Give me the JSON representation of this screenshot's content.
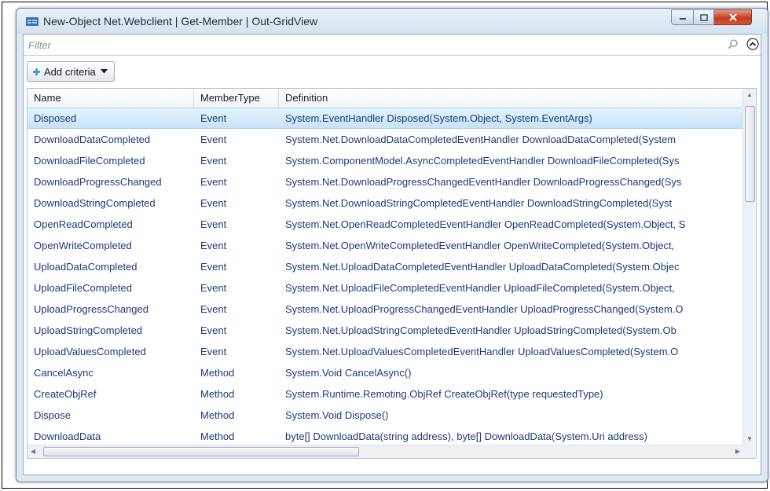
{
  "window": {
    "title": "New-Object Net.Webclient | Get-Member | Out-GridView"
  },
  "filter": {
    "placeholder": "Filter"
  },
  "toolbar": {
    "add_criteria_label": "Add criteria"
  },
  "grid": {
    "columns": [
      "Name",
      "MemberType",
      "Definition"
    ],
    "rows": [
      {
        "name": "Disposed",
        "type": "Event",
        "def": "System.EventHandler Disposed(System.Object, System.EventArgs)"
      },
      {
        "name": "DownloadDataCompleted",
        "type": "Event",
        "def": "System.Net.DownloadDataCompletedEventHandler DownloadDataCompleted(System"
      },
      {
        "name": "DownloadFileCompleted",
        "type": "Event",
        "def": "System.ComponentModel.AsyncCompletedEventHandler DownloadFileCompleted(Sys"
      },
      {
        "name": "DownloadProgressChanged",
        "type": "Event",
        "def": "System.Net.DownloadProgressChangedEventHandler DownloadProgressChanged(Sys"
      },
      {
        "name": "DownloadStringCompleted",
        "type": "Event",
        "def": "System.Net.DownloadStringCompletedEventHandler DownloadStringCompleted(Syst"
      },
      {
        "name": "OpenReadCompleted",
        "type": "Event",
        "def": "System.Net.OpenReadCompletedEventHandler OpenReadCompleted(System.Object, S"
      },
      {
        "name": "OpenWriteCompleted",
        "type": "Event",
        "def": "System.Net.OpenWriteCompletedEventHandler OpenWriteCompleted(System.Object,"
      },
      {
        "name": "UploadDataCompleted",
        "type": "Event",
        "def": "System.Net.UploadDataCompletedEventHandler UploadDataCompleted(System.Objec"
      },
      {
        "name": "UploadFileCompleted",
        "type": "Event",
        "def": "System.Net.UploadFileCompletedEventHandler UploadFileCompleted(System.Object,"
      },
      {
        "name": "UploadProgressChanged",
        "type": "Event",
        "def": "System.Net.UploadProgressChangedEventHandler UploadProgressChanged(System.O"
      },
      {
        "name": "UploadStringCompleted",
        "type": "Event",
        "def": "System.Net.UploadStringCompletedEventHandler UploadStringCompleted(System.Ob"
      },
      {
        "name": "UploadValuesCompleted",
        "type": "Event",
        "def": "System.Net.UploadValuesCompletedEventHandler UploadValuesCompleted(System.O"
      },
      {
        "name": "CancelAsync",
        "type": "Method",
        "def": "System.Void CancelAsync()"
      },
      {
        "name": "CreateObjRef",
        "type": "Method",
        "def": "System.Runtime.Remoting.ObjRef CreateObjRef(type requestedType)"
      },
      {
        "name": "Dispose",
        "type": "Method",
        "def": "System.Void Dispose()"
      },
      {
        "name": "DownloadData",
        "type": "Method",
        "def": "byte[] DownloadData(string address), byte[] DownloadData(System.Uri address)"
      }
    ]
  },
  "colors": {
    "selection": "#c7e3f9",
    "row_text": "#1c3a7a",
    "close_button": "#c43b22"
  }
}
